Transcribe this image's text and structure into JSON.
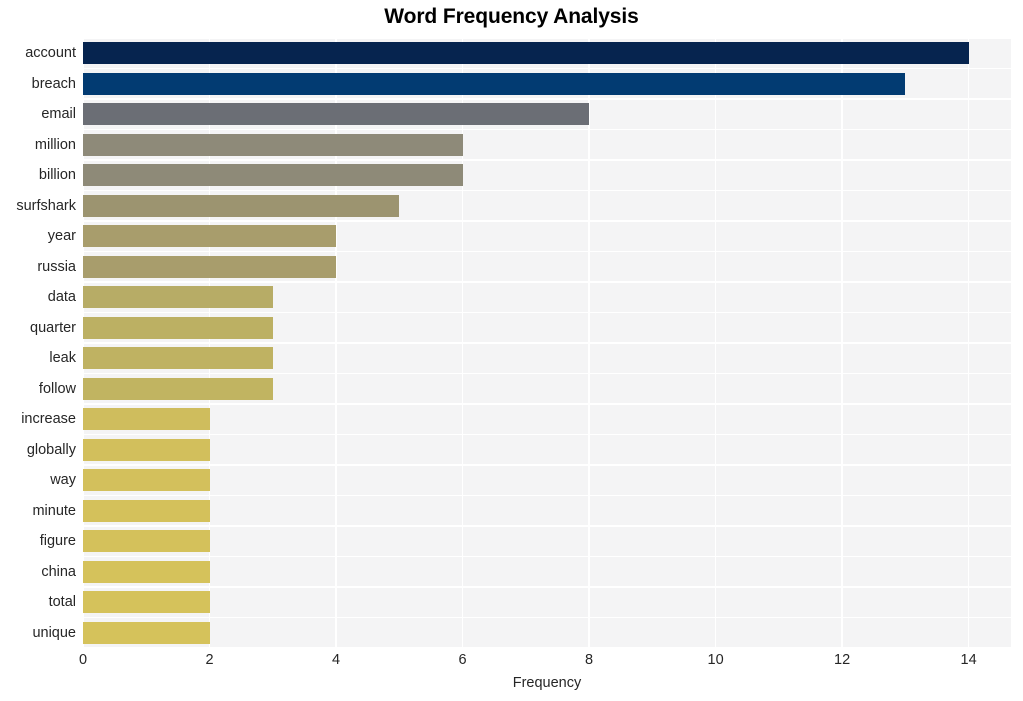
{
  "chart_data": {
    "type": "bar",
    "orientation": "horizontal",
    "title": "Word Frequency Analysis",
    "xlabel": "Frequency",
    "ylabel": "",
    "xlim": [
      0,
      14.67
    ],
    "xticks": [
      0,
      2,
      4,
      6,
      8,
      10,
      12,
      14
    ],
    "xtick_labels": [
      "0",
      "2",
      "4",
      "6",
      "8",
      "10",
      "12",
      "14"
    ],
    "grid": true,
    "legend": null,
    "categories": [
      "account",
      "breach",
      "email",
      "million",
      "billion",
      "surfshark",
      "year",
      "russia",
      "data",
      "quarter",
      "leak",
      "follow",
      "increase",
      "globally",
      "way",
      "minute",
      "figure",
      "china",
      "total",
      "unique"
    ],
    "values": [
      14,
      13,
      8,
      6,
      6,
      5,
      4,
      4,
      3,
      3,
      3,
      3,
      2,
      2,
      2,
      2,
      2,
      2,
      2,
      2
    ],
    "bar_colors": [
      "#06244f",
      "#023b72",
      "#6b6e75",
      "#8e8a79",
      "#8e8a78",
      "#9c9470",
      "#a89d6c",
      "#a89d6c",
      "#b7ac66",
      "#bcb063",
      "#bfb262",
      "#c1b461",
      "#cfbd5d",
      "#d2bf5c",
      "#d3c05c",
      "#d4c15b",
      "#d4c15b",
      "#d5c25b",
      "#d5c25b",
      "#d5c25b"
    ],
    "plot_background": "#f4f4f5",
    "grid_color": "#ffffff",
    "title_color": "#000000",
    "tick_color": "#262626"
  }
}
